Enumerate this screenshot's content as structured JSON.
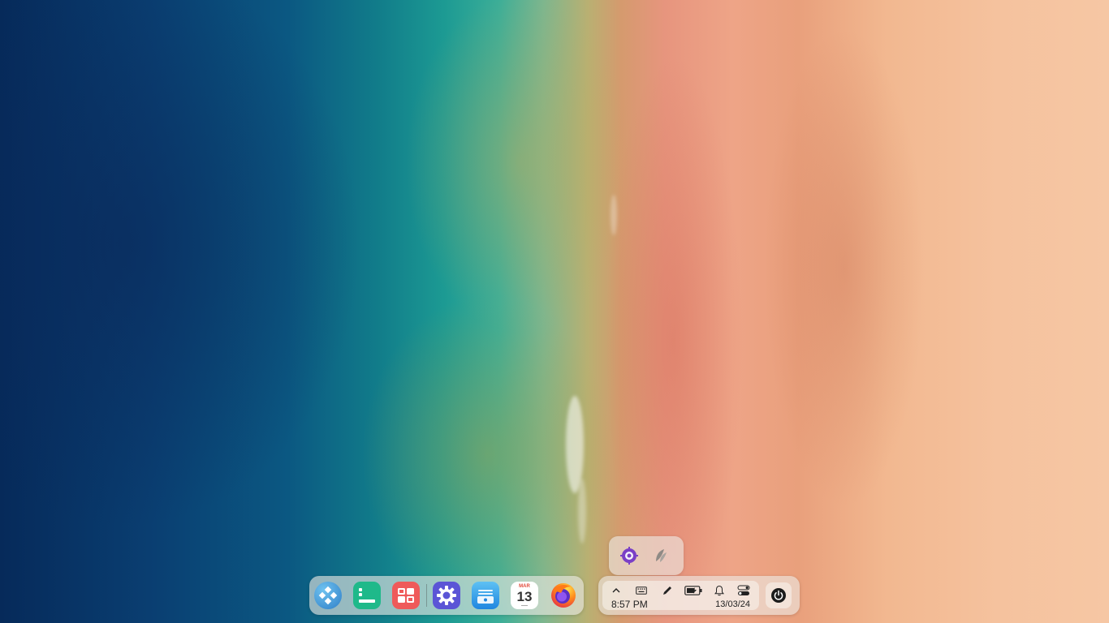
{
  "desktop": {
    "wallpaper": "aerial-beach"
  },
  "dock": {
    "items": [
      {
        "name": "launcher",
        "icon": "launcher-icon"
      },
      {
        "name": "multitasking-view",
        "icon": "multitasking-view-icon"
      },
      {
        "name": "workspaces",
        "icon": "workspaces-icon"
      },
      {
        "name": "settings",
        "icon": "settings-gear-icon"
      },
      {
        "name": "file-manager",
        "icon": "file-manager-icon"
      },
      {
        "name": "calendar",
        "icon": "calendar-icon",
        "month": "MAR",
        "day": "13"
      },
      {
        "name": "firefox",
        "icon": "firefox-icon"
      }
    ]
  },
  "tray_popup": {
    "items": [
      {
        "name": "purple-gear-app",
        "icon": "purple-gear-icon"
      },
      {
        "name": "leaf-app",
        "icon": "leaf-icon"
      }
    ]
  },
  "status": {
    "time": "8:57 PM",
    "date": "13/03/24",
    "icons": [
      "chevron-up-icon",
      "keyboard-icon",
      "pen-icon",
      "battery-icon",
      "bell-icon",
      "toggle-icon"
    ]
  },
  "colors": {
    "calendar_red": "#e04a3a",
    "multitask_green": "#1fb98a",
    "workspace_red": "#ef5a5a",
    "settings_purple": "#5b55d6",
    "filemanager_blue": "#2f9be8"
  }
}
